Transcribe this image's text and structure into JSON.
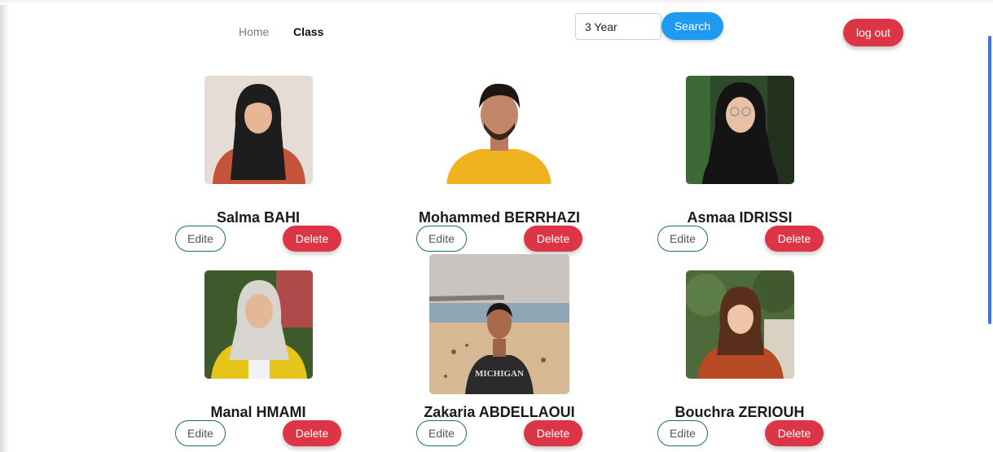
{
  "nav": {
    "home_label": "Home",
    "class_label": "Class"
  },
  "search": {
    "value": "3 Year",
    "button_label": "Search"
  },
  "logout_label": "log out",
  "students": [
    {
      "name": "Salma BAHI",
      "edit_label": "Edite",
      "delete_label": "Delete"
    },
    {
      "name": "Mohammed BERRHAZI",
      "edit_label": "Edite",
      "delete_label": "Delete"
    },
    {
      "name": "Asmaa IDRISSI",
      "edit_label": "Edite",
      "delete_label": "Delete"
    },
    {
      "name": "Manal HMAMI",
      "edit_label": "Edite",
      "delete_label": "Delete"
    },
    {
      "name": "Zakaria ABDELLAOUI",
      "edit_label": "Edite",
      "delete_label": "Delete"
    },
    {
      "name": "Bouchra ZERIOUH",
      "edit_label": "Edite",
      "delete_label": "Delete"
    }
  ],
  "colors": {
    "search_button": "#1e9bf0",
    "delete_button": "#dc3545",
    "edit_border": "#1b7a3f",
    "scroll_accent": "#3d6df0"
  }
}
